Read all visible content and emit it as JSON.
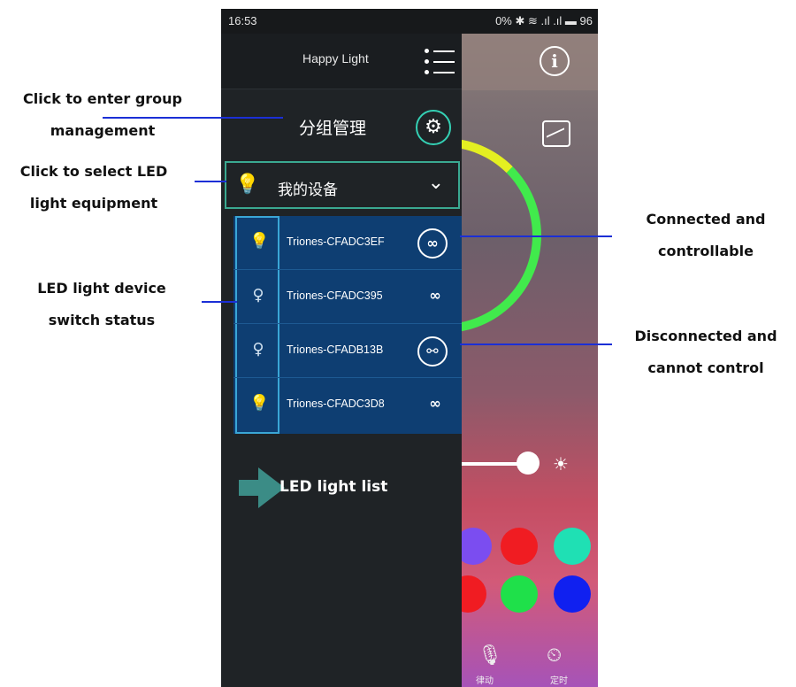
{
  "status_bar": {
    "time": "16:53",
    "right": "0% ✱ ≋ .ıl .ıl ▬ 96"
  },
  "app": {
    "title": "Happy Light"
  },
  "group": {
    "label": "分组管理"
  },
  "device_selector": {
    "label": "我的设备"
  },
  "devices": [
    {
      "name": "Triones-CFADC3EF",
      "switch": "on",
      "link": "connected"
    },
    {
      "name": "Triones-CFADC395",
      "switch": "off",
      "link": "connected"
    },
    {
      "name": "Triones-CFADB13B",
      "switch": "off",
      "link": "disconnected"
    },
    {
      "name": "Triones-CFADC3D8",
      "switch": "on",
      "link": "connected"
    }
  ],
  "list_label": "LED light list",
  "bottom_bar": {
    "left_label": "律动",
    "right_label": "定时"
  },
  "annotations": {
    "group_line1": "Click to enter group",
    "group_line2": "management",
    "select_line1": "Click to select LED",
    "select_line2": "light equipment",
    "status_line1": "LED light device",
    "status_line2": "switch status",
    "connected_line1": "Connected and",
    "connected_line2": "controllable",
    "disconnected_line1": "Disconnected and",
    "disconnected_line2": "cannot control"
  },
  "colors": {
    "accent": "#34d0b4",
    "list_bg": "#0e3e72",
    "annotation_line": "#1b2fd6",
    "swatches": [
      "#7b4df0",
      "#f01c22",
      "#1fe0b4",
      "#f01c22",
      "#1fe04a",
      "#1020f0"
    ]
  }
}
